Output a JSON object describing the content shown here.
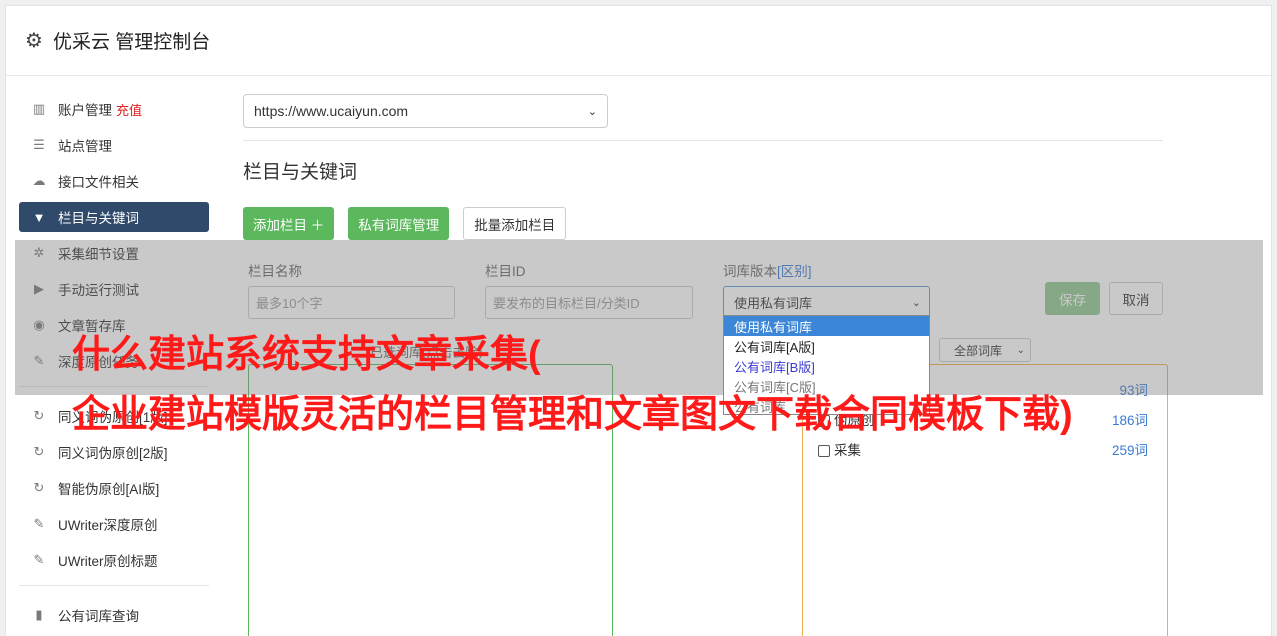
{
  "header": {
    "title": "优采云 管理控制台",
    "icon": "gear-icon"
  },
  "sidebar": {
    "items": [
      {
        "label": "账户管理",
        "extra": "充值",
        "icon": "bar-chart-icon"
      },
      {
        "label": "站点管理",
        "icon": "server-icon"
      },
      {
        "label": "接口文件相关",
        "icon": "cloud-upload-icon"
      },
      {
        "label": "栏目与关键词",
        "icon": "filter-icon",
        "active": true
      },
      {
        "label": "采集细节设置",
        "icon": "cogs-icon"
      },
      {
        "label": "手动运行测试",
        "icon": "play-circle-icon"
      },
      {
        "label": "文章暂存库",
        "icon": "database-icon"
      },
      {
        "label": "深度原创任务",
        "icon": "edit-icon"
      },
      {
        "label": "同义词伪原创[1版]",
        "icon": "refresh-icon"
      },
      {
        "label": "同义词伪原创[2版]",
        "icon": "refresh-icon"
      },
      {
        "label": "智能伪原创[AI版]",
        "icon": "refresh-icon"
      },
      {
        "label": "UWriter深度原创",
        "icon": "edit-icon"
      },
      {
        "label": "UWriter原创标题",
        "icon": "edit-icon"
      },
      {
        "label": "公有词库查询",
        "icon": "book-icon"
      }
    ]
  },
  "main": {
    "site_select": "https://www.ucaiyun.com",
    "section_title": "栏目与关键词",
    "buttons": {
      "add_column": "添加栏目 ＋",
      "private_lib": "私有词库管理",
      "batch_add": "批量添加栏目"
    },
    "form": {
      "name_label": "栏目名称",
      "name_placeholder": "最多10个字",
      "id_label": "栏目ID",
      "id_placeholder": "要发布的目标栏目/分类ID",
      "version_label": "词库版本",
      "version_link": "[区别]",
      "version_value": "使用私有词库",
      "save": "保存",
      "cancel": "取消"
    },
    "selected_label": "已选词库(点击去除)",
    "all_lib": "全部词库",
    "libraries": [
      {
        "name": "",
        "count": "93词"
      },
      {
        "name": "伪原创",
        "count": "186词"
      },
      {
        "name": "采集",
        "count": "259词"
      }
    ],
    "dropdown": [
      "使用私有词库",
      "公有词库[A版]",
      "公有词库[B版]",
      "公有词库[C版]",
      "公有词库"
    ]
  },
  "watermark": {
    "line1": "什么建站系统支持文章采集(",
    "line2": "企业建站模版灵活的栏目管理和文章图文下载合同模板下载)"
  },
  "colors": {
    "active_nav": "#2f4a6a",
    "green": "#5cb85c",
    "watermark": "#ff1a1a",
    "link": "#3a7bd5"
  }
}
